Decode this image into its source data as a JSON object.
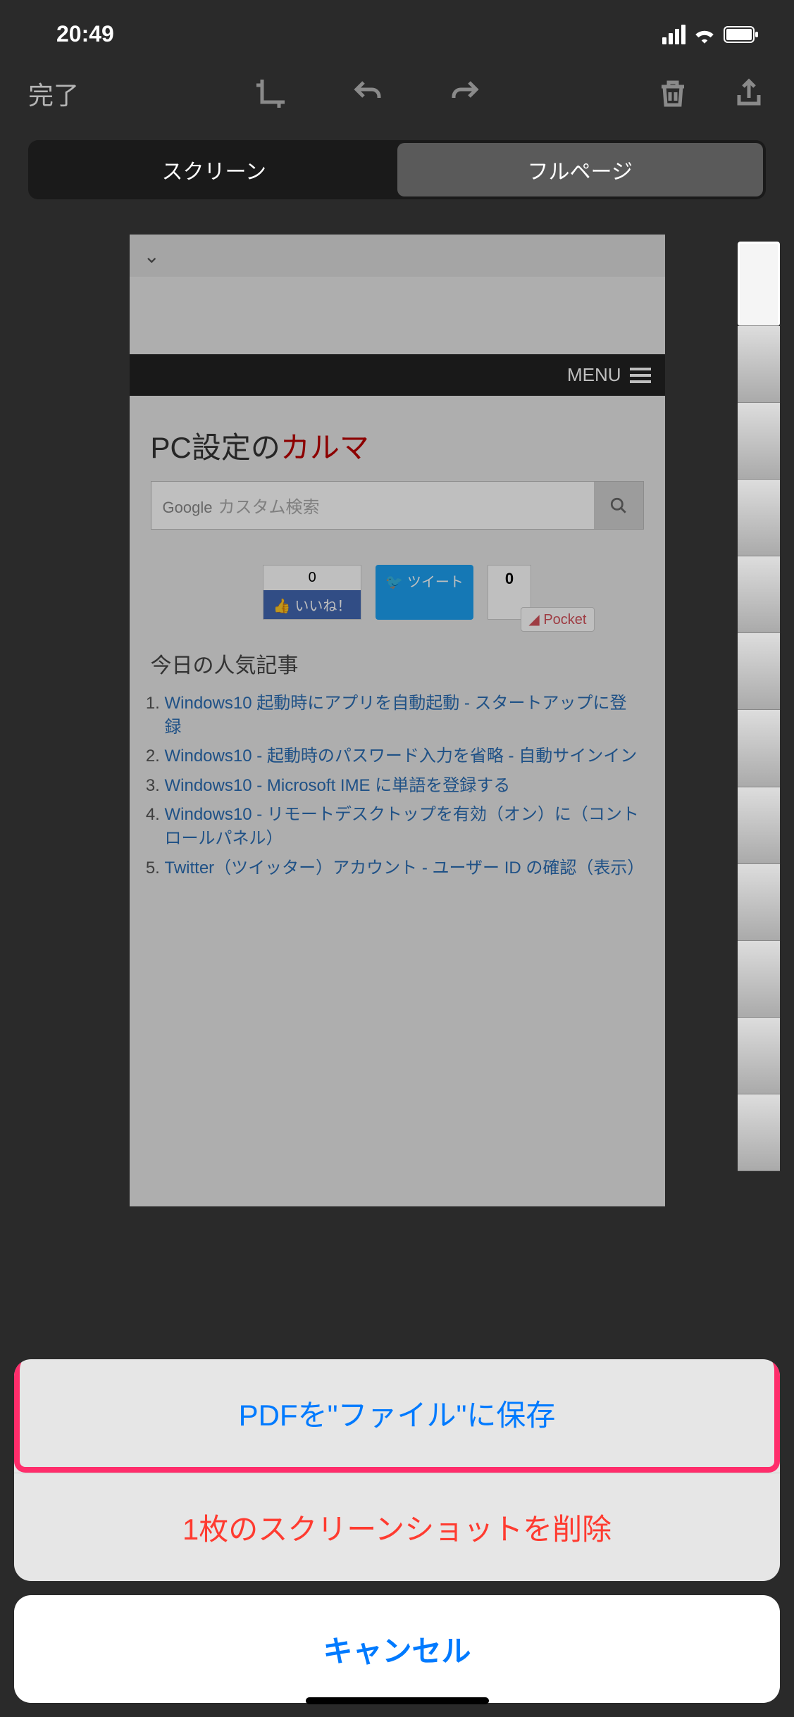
{
  "status": {
    "time": "20:49"
  },
  "toolbar": {
    "done": "完了"
  },
  "segmented": {
    "screen": "スクリーン",
    "fullpage": "フルページ"
  },
  "preview": {
    "menu_label": "MENU",
    "site_title_a": "PC設定の",
    "site_title_b": "カルマ",
    "search_brand": "Google",
    "search_placeholder": "カスタム検索",
    "like_count": "0",
    "like_label": "いいね！",
    "tweet_label": "ツイート",
    "zero": "0",
    "pocket": "Pocket",
    "section": "今日の人気記事",
    "articles": [
      "Windows10 起動時にアプリを自動起動 - スタートアップに登録",
      "Windows10 - 起動時のパスワード入力を省略 - 自動サインイン",
      "Windows10 - Microsoft IME に単語を登録する",
      "Windows10 - リモートデスクトップを有効（オン）に（コントロールパネル）",
      "Twitter（ツイッター）アカウント - ユーザー ID の確認（表示）"
    ]
  },
  "sheet": {
    "save_pdf": "PDFを\"ファイル\"に保存",
    "delete": "1枚のスクリーンショットを削除",
    "cancel": "キャンセル"
  }
}
